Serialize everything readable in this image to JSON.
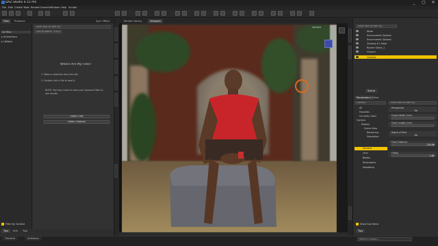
{
  "app": {
    "title": "DAZ Studio 4.15 Pro",
    "window_controls": [
      "_",
      "▢",
      "✕"
    ]
  },
  "menu": [
    "File",
    "Edit",
    "Create",
    "Tools",
    "Render",
    "Connect",
    "Window",
    "Help",
    "Scripts"
  ],
  "left_panel": {
    "tabs": [
      "Files",
      "Products"
    ],
    "tab_right": "Sync Offline",
    "tree": [
      {
        "label": "All Files",
        "selected": true
      },
      {
        "label": "▸ Animations",
        "selected": false
      },
      {
        "label": "▸ Utilities",
        "selected": false
      }
    ],
    "search_placeholder": "Enter text to filter by...",
    "sort_label": "Sort by Name : A to Z",
    "help": {
      "title": "Where Are My Files?",
      "step1": "1. Make a selection from the left.",
      "step2": "2. Double-click a file to load it.",
      "note": "NOTE: You may need to clear your keyword filter to",
      "note2": "see results."
    },
    "buttons": [
      "Video: Files",
      "Video: Products"
    ],
    "filter_by_context": "Filter By Context",
    "bottom_tabs": [
      "Tips",
      "Info",
      "Tool"
    ]
  },
  "viewport": {
    "tabs": [
      "Render Library",
      "Viewport"
    ],
    "camera_label": "Camera"
  },
  "right_panel": {
    "scene_tab": "Scene",
    "scene_search": "Enter text to filter by...",
    "scene_items": [
      {
        "label": "Node",
        "selected": false
      },
      {
        "label": "Environment Options",
        "selected": false
      },
      {
        "label": "Environment Options",
        "selected": false
      },
      {
        "label": "Genesis 8.1 Male",
        "selected": false
      },
      {
        "label": "Rocker Stone_1",
        "selected": false
      },
      {
        "label": "Ground",
        "selected": false
      },
      {
        "label": "Camera",
        "selected": true
      }
    ],
    "params_tabs": [
      "Parameters",
      "Editor"
    ],
    "params_header": "Camera",
    "params_search": "Enter text to filter by...",
    "groups": [
      {
        "label": "All",
        "selected": false
      },
      {
        "label": "Favorites",
        "selected": false
      },
      {
        "label": "Currently Used",
        "selected": false
      },
      {
        "label": "Camera",
        "selected": false
      },
      {
        "label": "Display",
        "selected": false
      },
      {
        "label": "Scene View",
        "selected": false
      },
      {
        "label": "Rendering",
        "selected": false
      },
      {
        "label": "Simulation",
        "selected": false
      },
      {
        "label": "Camera",
        "selected": true
      },
      {
        "label": "Lens",
        "selected": false
      },
      {
        "label": "Blades",
        "selected": false
      },
      {
        "label": "Dimensions",
        "selected": false
      },
      {
        "label": "Headlamp",
        "selected": false
      }
    ],
    "properties": [
      {
        "label": "Perspective",
        "value": "On"
      },
      {
        "label": "Frame Width (mm)",
        "value": ""
      },
      {
        "label": "Focal Length (mm)",
        "value": ""
      },
      {
        "label": "Depth of Field",
        "value": "On"
      },
      {
        "label": "Focal Distance",
        "value": "224.98"
      },
      {
        "label": "F/Stop",
        "value": "1.60"
      }
    ],
    "show_sub_items": "Show Sub Items",
    "bottom_tab": "Tips"
  },
  "bottom": {
    "tabs": [
      "Timeline",
      "Aniblocks"
    ],
    "lesson_placeholder": "Select a Lesson..."
  },
  "colors": {
    "accent": "#f0c400",
    "cursor_ring": "#e06a1a"
  }
}
